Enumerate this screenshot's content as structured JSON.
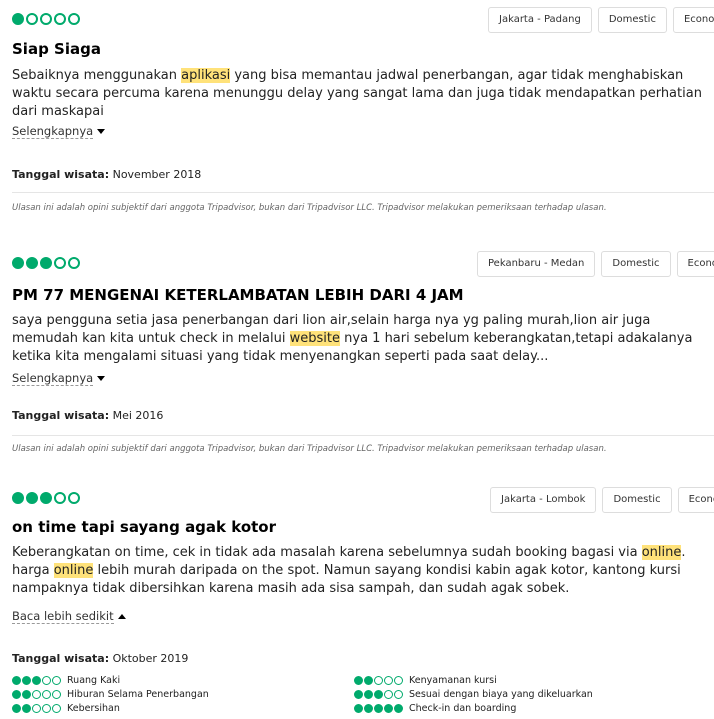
{
  "reviews": [
    {
      "rating": 1,
      "tags": [
        "Jakarta - Padang",
        "Domestic",
        "Economy"
      ],
      "title": "Siap Siaga",
      "body_parts": [
        {
          "t": "Sebaiknya menggunakan "
        },
        {
          "t": "aplikasi",
          "hl": true
        },
        {
          "t": " yang bisa memantau jadwal penerbangan, agar tidak menghabiskan waktu secara percuma karena menunggu delay yang sangat lama dan juga tidak mendapatkan perhatian dari maskapai"
        }
      ],
      "more_label": "Selengkapnya",
      "date_label": "Tanggal wisata:",
      "date_value": "November 2018",
      "disclaimer": "Ulasan ini adalah opini subjektif dari anggota Tripadvisor, bukan dari Tripadvisor LLC. Tripadvisor melakukan pemeriksaan terhadap ulasan."
    },
    {
      "rating": 3,
      "tags": [
        "Pekanbaru - Medan",
        "Domestic",
        "Economy"
      ],
      "title": "PM 77 MENGENAI KETERLAMBATAN LEBIH DARI 4 JAM",
      "body_parts": [
        {
          "t": "saya pengguna setia jasa penerbangan dari lion air,selain harga nya yg paling murah,lion air juga memudah kan kita untuk check in melalui "
        },
        {
          "t": "website",
          "hl": true
        },
        {
          "t": " nya 1 hari sebelum keberangkatan,tetapi adakalanya ketika kita mengalami situasi yang tidak menyenangkan seperti pada saat delay..."
        }
      ],
      "more_label": "Selengkapnya",
      "date_label": "Tanggal wisata:",
      "date_value": "Mei 2016",
      "disclaimer": "Ulasan ini adalah opini subjektif dari anggota Tripadvisor, bukan dari Tripadvisor LLC. Tripadvisor melakukan pemeriksaan terhadap ulasan."
    },
    {
      "rating": 3,
      "tags": [
        "Jakarta - Lombok",
        "Domestic",
        "Economy"
      ],
      "title": "on time tapi sayang agak kotor",
      "body_parts": [
        {
          "t": "Keberangkatan on time, cek in tidak ada masalah karena sebelumnya sudah booking bagasi via "
        },
        {
          "t": "online",
          "hl": true
        },
        {
          "t": ". harga "
        },
        {
          "t": "online",
          "hl": true
        },
        {
          "t": " lebih murah daripada on the spot. Namun sayang kondisi kabin agak kotor, kantong kursi nampaknya tidak dibersihkan karena masih ada sisa sampah, dan sudah agak sobek."
        }
      ],
      "more_label": "Baca lebih sedikit",
      "date_label": "Tanggal wisata:",
      "date_value": "Oktober 2019",
      "subratings": [
        {
          "label": "Ruang Kaki",
          "rating": 3
        },
        {
          "label": "Kenyamanan kursi",
          "rating": 2
        },
        {
          "label": "Hiburan Selama Penerbangan",
          "rating": 2
        },
        {
          "label": "Sesuai dengan biaya yang dikeluarkan",
          "rating": 3
        },
        {
          "label": "Kebersihan",
          "rating": 2
        },
        {
          "label": "Check-in dan boarding",
          "rating": 5
        }
      ]
    }
  ],
  "colors": {
    "bubble": "#00aa6c",
    "highlight": "#ffe27a"
  }
}
